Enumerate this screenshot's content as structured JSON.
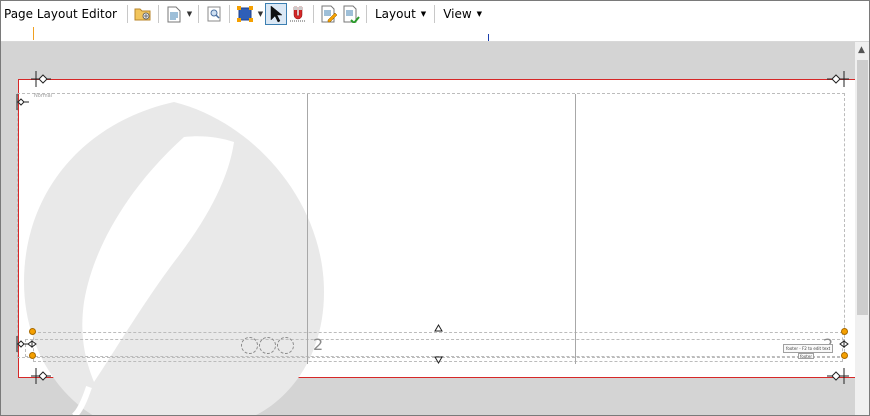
{
  "toolbar": {
    "title": "Page Layout Editor",
    "layout_label": "Layout",
    "view_label": "View",
    "icons": [
      "open-folder-icon",
      "page-template-icon",
      "preview-icon",
      "frame-select-icon",
      "pointer-icon",
      "magnet-icon",
      "edit-page-icon",
      "edit-page-alt-icon"
    ]
  },
  "page": {
    "style_label": "Normal",
    "page_number_left": "2",
    "page_number_right": "2",
    "footer_tooltip": "footer - F2 to edit text",
    "footer_tooltip_small": "footer"
  },
  "colors": {
    "page_border": "#d62828",
    "handle": "#f5a000",
    "selection": "#3c7fb1"
  }
}
